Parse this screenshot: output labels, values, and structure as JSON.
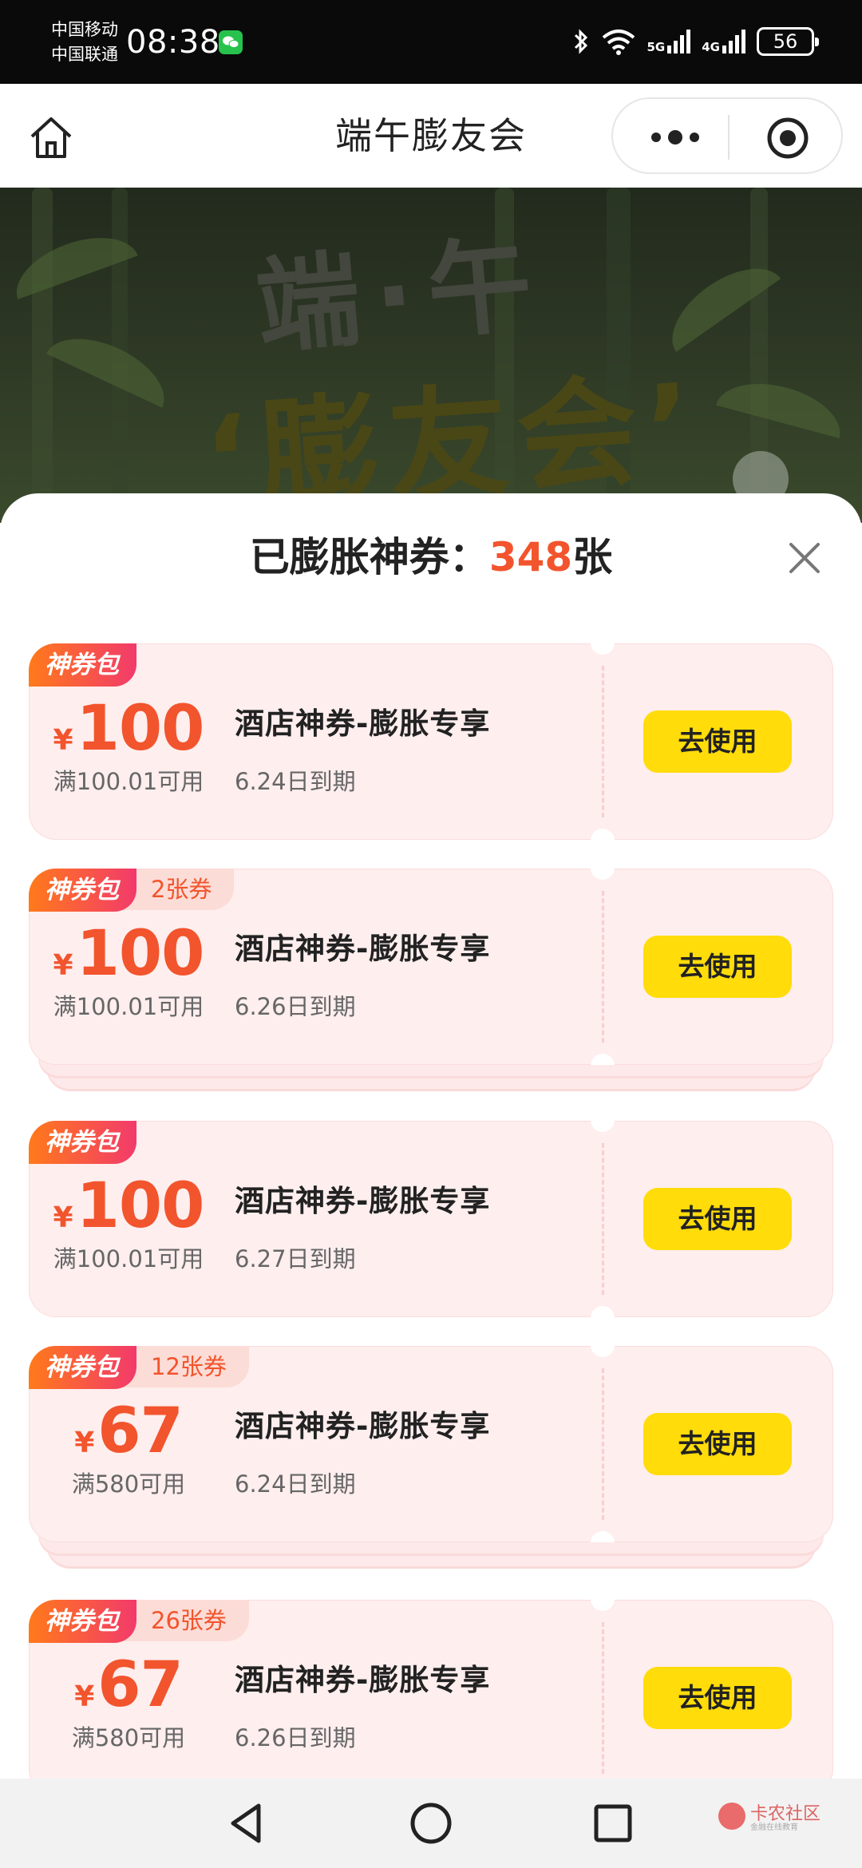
{
  "status_bar": {
    "carrier1": "中国移动",
    "carrier2": "中国联通",
    "time": "08:38",
    "net5g": "5G",
    "net4g": "4G",
    "battery": "56"
  },
  "title_bar": {
    "title": "端午膨友会"
  },
  "banner": {
    "line1": "端·午",
    "line2": "‘膨友会’"
  },
  "sheet": {
    "header_prefix": "已膨胀神券：",
    "count": "348",
    "header_suffix": "张"
  },
  "coupons": [
    {
      "tag": "神券包",
      "extra": "",
      "currency": "¥",
      "amount": "100",
      "condition": "满100.01可用",
      "name": "酒店神券-膨胀专享",
      "expiry": "6.24日到期",
      "button": "去使用",
      "stacked": false
    },
    {
      "tag": "神券包",
      "extra": "2张券",
      "currency": "¥",
      "amount": "100",
      "condition": "满100.01可用",
      "name": "酒店神券-膨胀专享",
      "expiry": "6.26日到期",
      "button": "去使用",
      "stacked": true
    },
    {
      "tag": "神券包",
      "extra": "",
      "currency": "¥",
      "amount": "100",
      "condition": "满100.01可用",
      "name": "酒店神券-膨胀专享",
      "expiry": "6.27日到期",
      "button": "去使用",
      "stacked": false
    },
    {
      "tag": "神券包",
      "extra": "12张券",
      "currency": "¥",
      "amount": "67",
      "condition": "满580可用",
      "name": "酒店神券-膨胀专享",
      "expiry": "6.24日到期",
      "button": "去使用",
      "stacked": true
    },
    {
      "tag": "神券包",
      "extra": "26张券",
      "currency": "¥",
      "amount": "67",
      "condition": "满580可用",
      "name": "酒店神券-膨胀专享",
      "expiry": "6.26日到期",
      "button": "去使用",
      "stacked": false
    }
  ],
  "watermark": {
    "text": "卡农社区",
    "sub": "金融在线教育"
  },
  "colors": {
    "accent": "#f2542d",
    "button": "#ffdc0a",
    "card": "#feeeee"
  }
}
